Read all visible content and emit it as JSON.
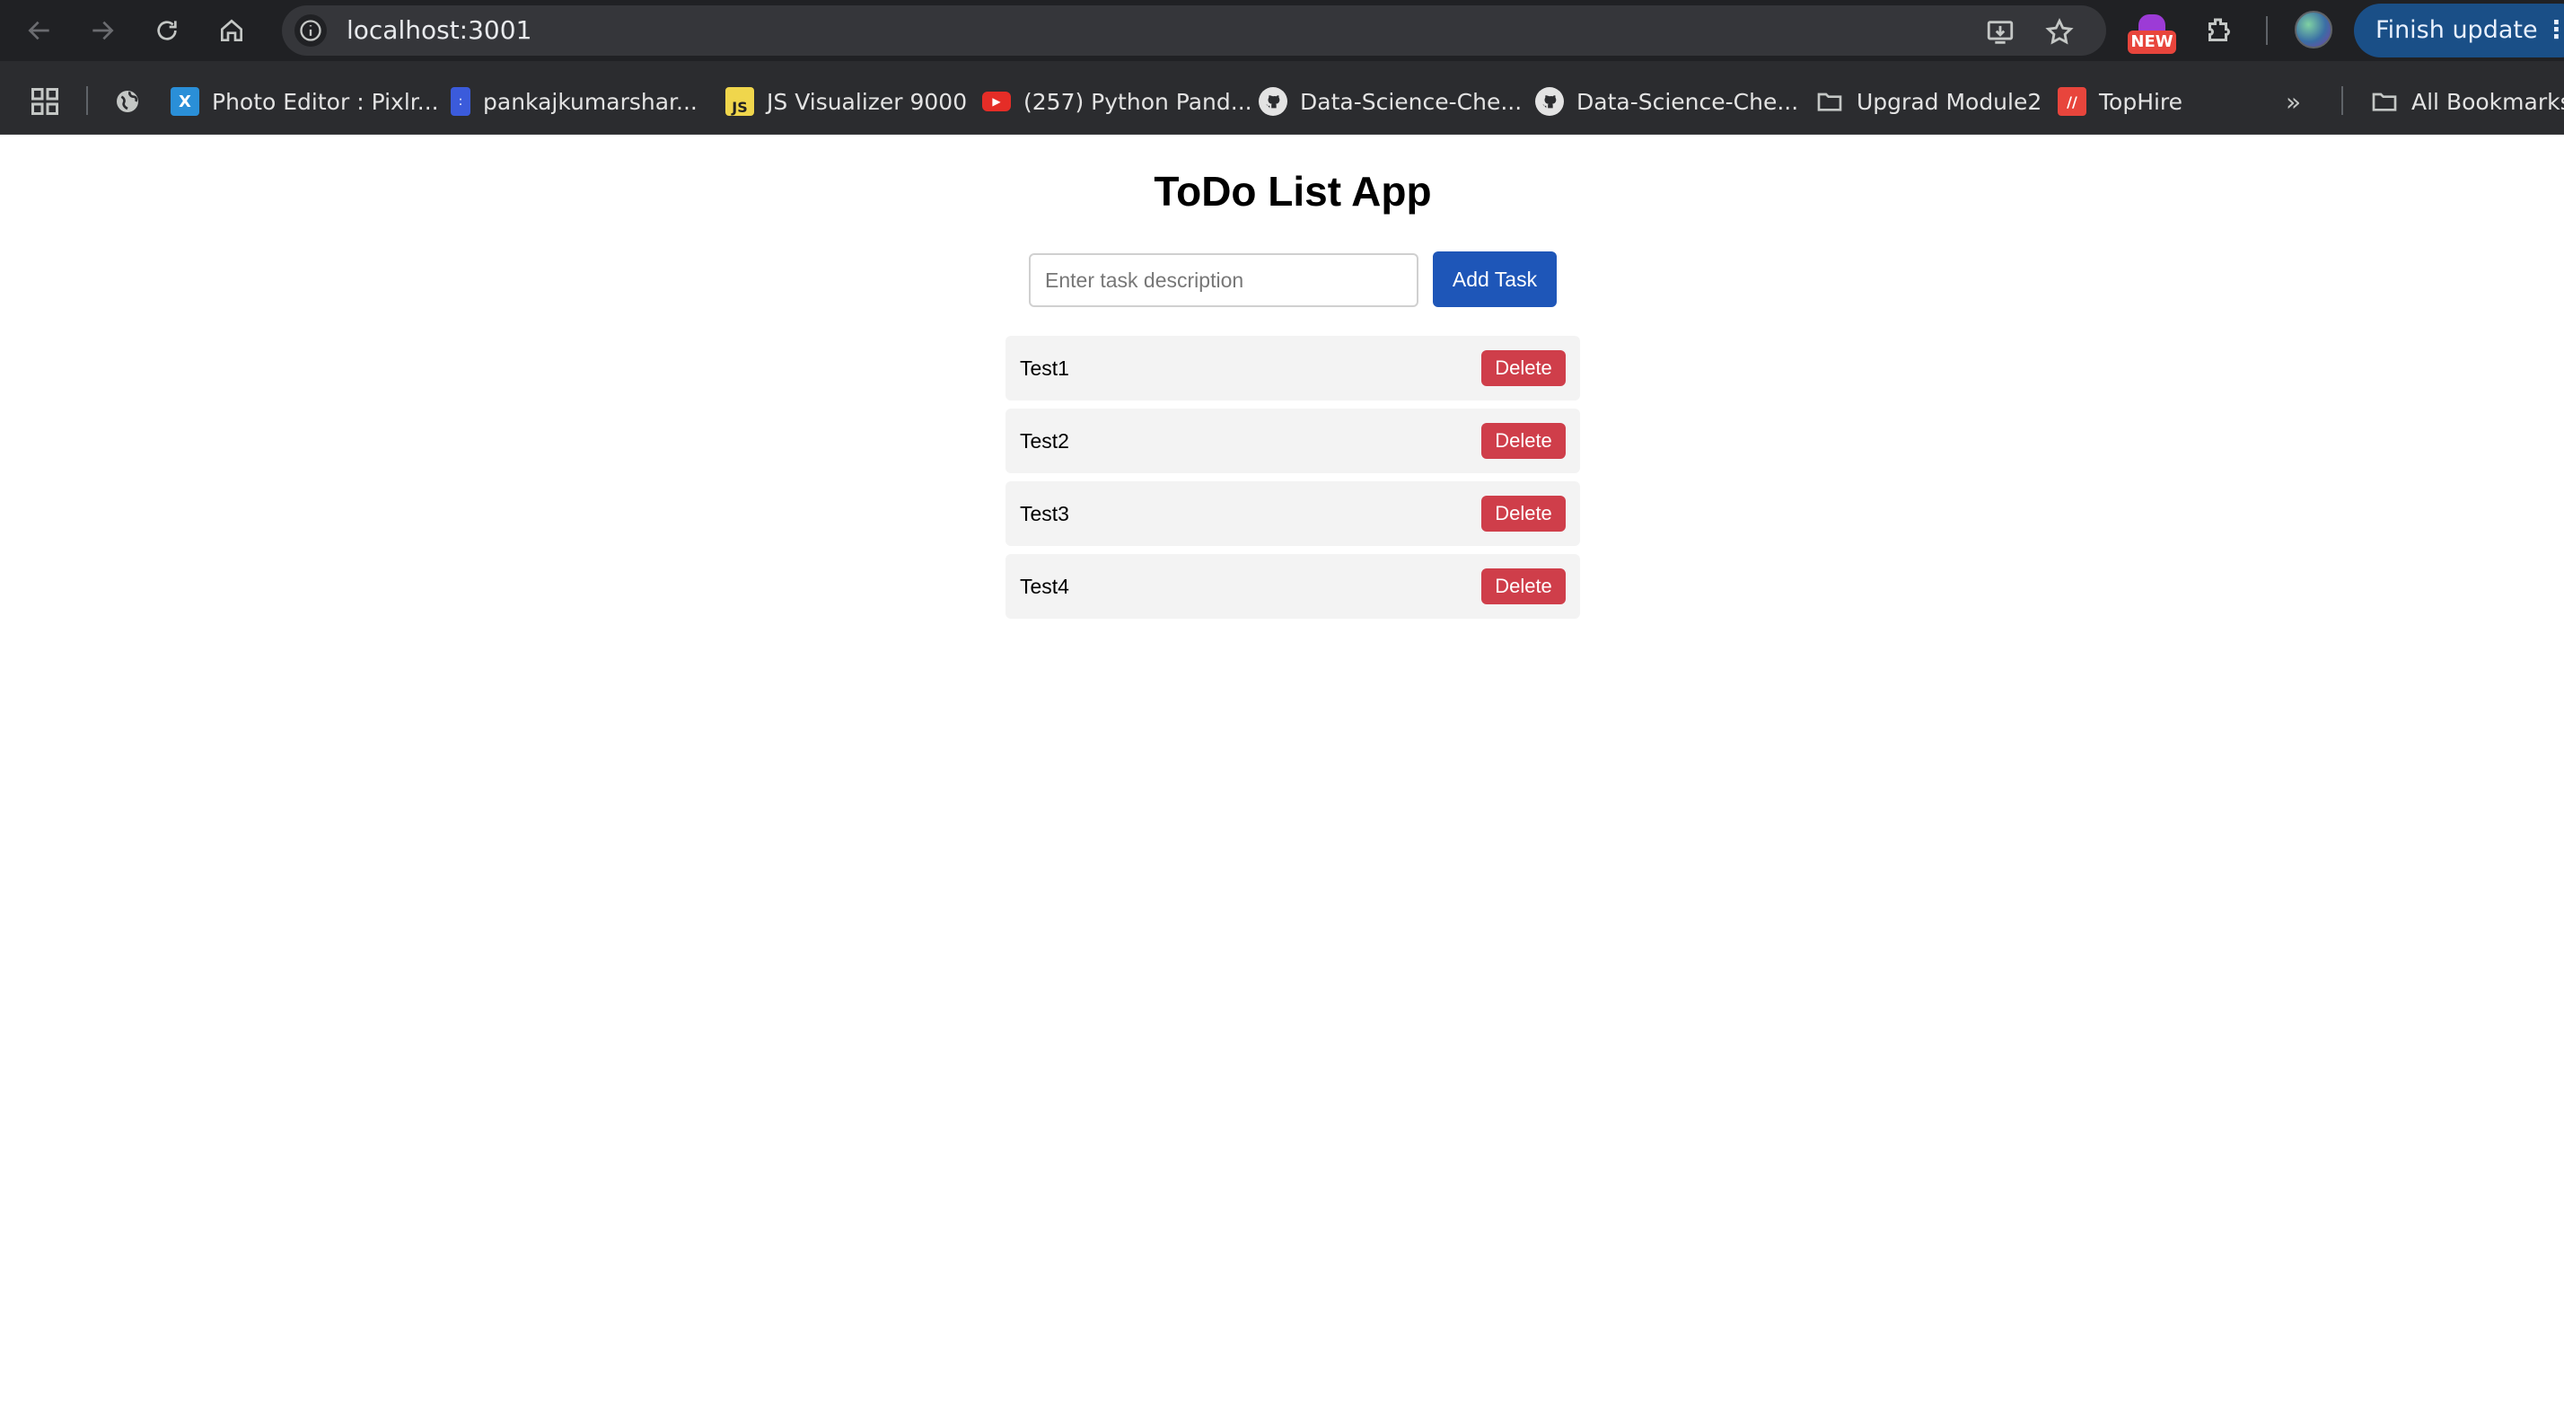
{
  "browser": {
    "url": "localhost:3001",
    "finish_update_label": "Finish update",
    "new_badge_label": "NEW",
    "bookmarks": [
      {
        "label": "Photo Editor : Pixlr...",
        "icon": "pixlr-icon"
      },
      {
        "label": "pankajkumarshar...",
        "icon": "doc-icon"
      },
      {
        "label": "JS Visualizer 9000",
        "icon": "js-icon"
      },
      {
        "label": "(257) Python Pand...",
        "icon": "youtube-icon"
      },
      {
        "label": "Data-Science-Che...",
        "icon": "github-icon"
      },
      {
        "label": "Data-Science-Che...",
        "icon": "github-icon"
      },
      {
        "label": "Upgrad Module2",
        "icon": "folder-icon"
      },
      {
        "label": "TopHire",
        "icon": "tophire-icon"
      }
    ],
    "all_bookmarks_label": "All Bookmarks",
    "colors": {
      "toolbar_bg": "#202124",
      "update_button": "#1a4f87"
    }
  },
  "app": {
    "title": "ToDo List App",
    "input_placeholder": "Enter task description",
    "input_value": "",
    "add_button_label": "Add Task",
    "tasks": [
      {
        "text": "Test1",
        "delete_label": "Delete"
      },
      {
        "text": "Test2",
        "delete_label": "Delete"
      },
      {
        "text": "Test3",
        "delete_label": "Delete"
      },
      {
        "text": "Test4",
        "delete_label": "Delete"
      }
    ],
    "colors": {
      "add_button": "#1e56b8",
      "delete_button": "#cf3e4a",
      "row_bg": "#f3f3f3"
    }
  }
}
